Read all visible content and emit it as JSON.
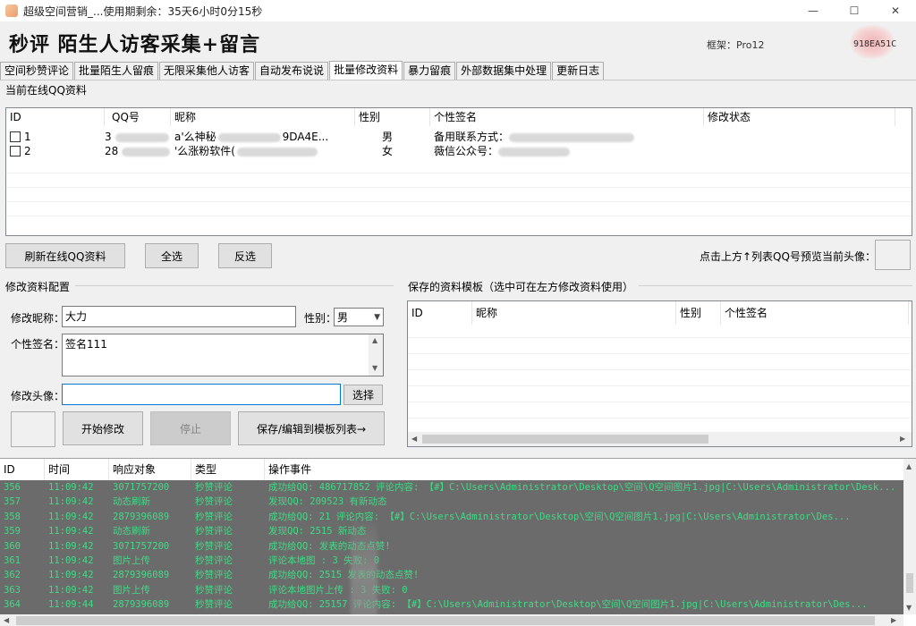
{
  "window": {
    "title": "超级空间营销_...使用期剩余：35天6小时0分15秒",
    "minimize": "—",
    "maximize": "☐",
    "close": "✕"
  },
  "header": {
    "banner": "秒评 陌生人访客采集+留言",
    "framework": "框架：Pro12",
    "version": "918EA51C"
  },
  "tabs": [
    {
      "label": "空间秒赞评论",
      "active": false
    },
    {
      "label": "批量陌生人留痕",
      "active": false
    },
    {
      "label": "无限采集他人访客",
      "active": false
    },
    {
      "label": "自动发布说说",
      "active": false
    },
    {
      "label": "批量修改资料",
      "active": true
    },
    {
      "label": "暴力留痕",
      "active": false
    },
    {
      "label": "外部数据集中处理",
      "active": false
    },
    {
      "label": "更新日志",
      "active": false
    }
  ],
  "online": {
    "group_title": "当前在线QQ资料",
    "columns": [
      "ID",
      "QQ号",
      "昵称",
      "性别",
      "个性签名",
      "修改状态"
    ],
    "rows": [
      {
        "id": "1",
        "qq": "3",
        "nick": "a'么神秘",
        "nick_tail": "9DA4E...",
        "gender": "男",
        "sig": "备用联系方式：",
        "status": ""
      },
      {
        "id": "2",
        "qq": "28",
        "nick": "'么涨粉软件(",
        "nick_tail": "",
        "gender": "女",
        "sig": "薇信公众号：",
        "status": ""
      }
    ],
    "refresh_button": "刷新在线QQ资料",
    "select_all_button": "全选",
    "invert_button": "反选",
    "preview_hint": "点击上方↑列表QQ号预览当前头像："
  },
  "config": {
    "group_title": "修改资料配置",
    "nickname_label": "修改昵称：",
    "nickname_value": "大力",
    "gender_label": "性别：",
    "gender_value": "男",
    "signature_label": "个性签名：",
    "signature_value": "签名111",
    "avatar_label": "修改头像：",
    "avatar_value": "",
    "choose_button": "选择",
    "start_button": "开始修改",
    "stop_button": "停止",
    "save_button": "保存/编辑到模板列表→"
  },
  "templates": {
    "group_title": "保存的资料模板（选中可在左方修改资料使用）",
    "columns": [
      "ID",
      "昵称",
      "性别",
      "个性签名"
    ]
  },
  "log": {
    "columns": [
      "ID",
      "时间",
      "响应对象",
      "类型",
      "操作事件"
    ],
    "rows": [
      {
        "id": "356",
        "time": "11:09:42",
        "target": "3071757200",
        "type": "秒赞评论",
        "event": "成功给QQ: 486717852 评论内容: 【#】C:\\Users\\Administrator\\Desktop\\空间\\Q空间图片1.jpg|C:\\Users\\Administrator\\Desk..."
      },
      {
        "id": "357",
        "time": "11:09:42",
        "target": "动态刷新",
        "type": "秒赞评论",
        "event": "发现QQ: 209523    有新动态"
      },
      {
        "id": "358",
        "time": "11:09:42",
        "target": "2879396089",
        "type": "秒赞评论",
        "event": "成功给QQ: 21    评论内容: 【#】C:\\Users\\Administrator\\Desktop\\空间\\Q空间图片1.jpg|C:\\Users\\Administrator\\Des..."
      },
      {
        "id": "359",
        "time": "11:09:42",
        "target": "动态刷新",
        "type": "秒赞评论",
        "event": "发现QQ: 2515    新动态"
      },
      {
        "id": "360",
        "time": "11:09:42",
        "target": "3071757200",
        "type": "秒赞评论",
        "event": "成功给QQ:     发表的动态点赞!"
      },
      {
        "id": "361",
        "time": "11:09:42",
        "target": "图片上传",
        "type": "秒赞评论",
        "event": "评论本地图    : 3 失败: 0"
      },
      {
        "id": "362",
        "time": "11:09:42",
        "target": "2879396089",
        "type": "秒赞评论",
        "event": "成功给QQ: 2515    发表的动态点赞!"
      },
      {
        "id": "363",
        "time": "11:09:42",
        "target": "图片上传",
        "type": "秒赞评论",
        "event": "评论本地图片上传    : 3 失败: 0"
      },
      {
        "id": "364",
        "time": "11:09:44",
        "target": "2879396089",
        "type": "秒赞评论",
        "event": "成功给QQ: 25157    评论内容: 【#】C:\\Users\\Administrator\\Desktop\\空间\\Q空间图片1.jpg|C:\\Users\\Administrator\\Des..."
      }
    ]
  }
}
